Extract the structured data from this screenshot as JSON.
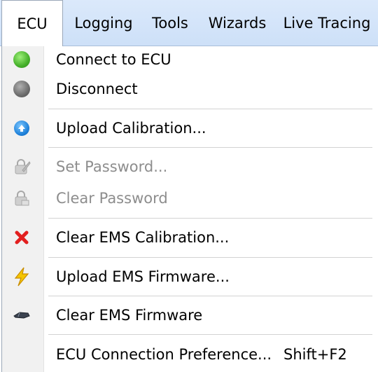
{
  "menubar": {
    "items": [
      {
        "label": "ECU",
        "active": true
      },
      {
        "label": "Logging"
      },
      {
        "label": "Tools"
      },
      {
        "label": "Wizards"
      },
      {
        "label": "Live Tracing"
      }
    ]
  },
  "menu": {
    "items": [
      {
        "label": "Connect to ECU",
        "icon": "green-dot-icon",
        "enabled": true
      },
      {
        "label": "Disconnect",
        "icon": "gray-dot-icon",
        "enabled": true
      },
      {
        "label": "Upload Calibration...",
        "icon": "upload-icon",
        "enabled": true
      },
      {
        "label": "Set Password...",
        "icon": "set-password-icon",
        "enabled": false
      },
      {
        "label": "Clear Password",
        "icon": "lock-icon",
        "enabled": false
      },
      {
        "label": "Clear EMS Calibration...",
        "icon": "red-x-icon",
        "enabled": true
      },
      {
        "label": "Upload EMS Firmware...",
        "icon": "lightning-icon",
        "enabled": true
      },
      {
        "label": "Clear EMS Firmware",
        "icon": "eraser-icon",
        "enabled": true
      },
      {
        "label": "ECU Connection Preference...",
        "shortcut": "Shift+F2",
        "icon": null,
        "enabled": true
      }
    ]
  },
  "colors": {
    "menubar_bg": "#d6e6fa",
    "gutter_bg": "#f1f1f1",
    "disabled_text": "#8d8d8d",
    "separator": "#d3d3d3"
  }
}
